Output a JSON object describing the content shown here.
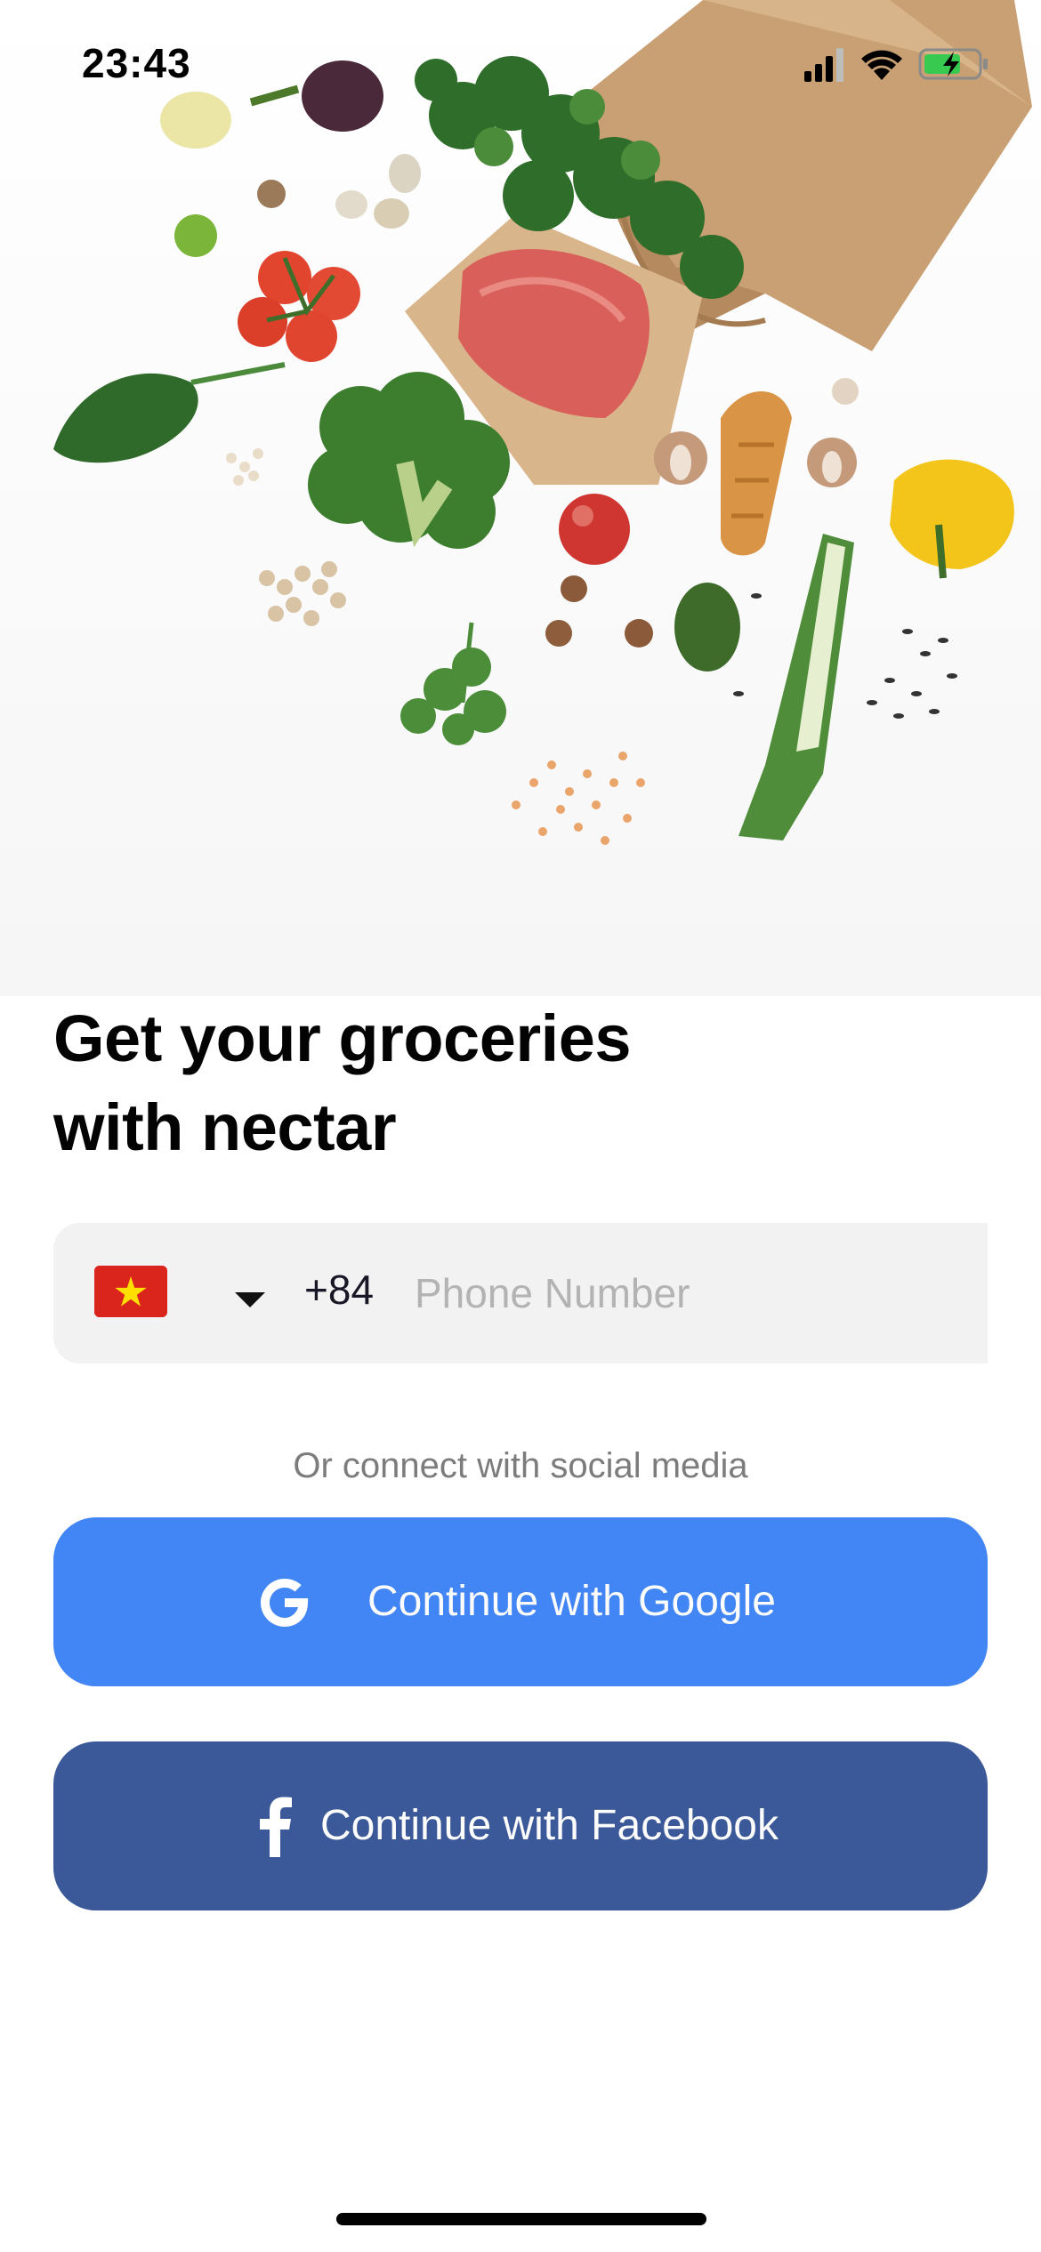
{
  "status_bar": {
    "time": "23:43",
    "icons": [
      "cellular-signal-icon",
      "wifi-icon",
      "battery-charging-icon"
    ]
  },
  "hero": {
    "image": "groceries-spilling-from-paper-bag-illustration"
  },
  "headline": {
    "line1": "Get your groceries",
    "line2": "with nectar"
  },
  "phone_field": {
    "country_flag": "vietnam-flag-icon",
    "dial_code": "+84",
    "placeholder": "Phone Number",
    "value": ""
  },
  "divider_text": "Or connect with social media",
  "buttons": {
    "google": {
      "label": "Continue with Google",
      "icon": "google-icon",
      "color": "#4285f4"
    },
    "facebook": {
      "label": "Continue with Facebook",
      "icon": "facebook-icon",
      "color": "#3b5998"
    }
  }
}
